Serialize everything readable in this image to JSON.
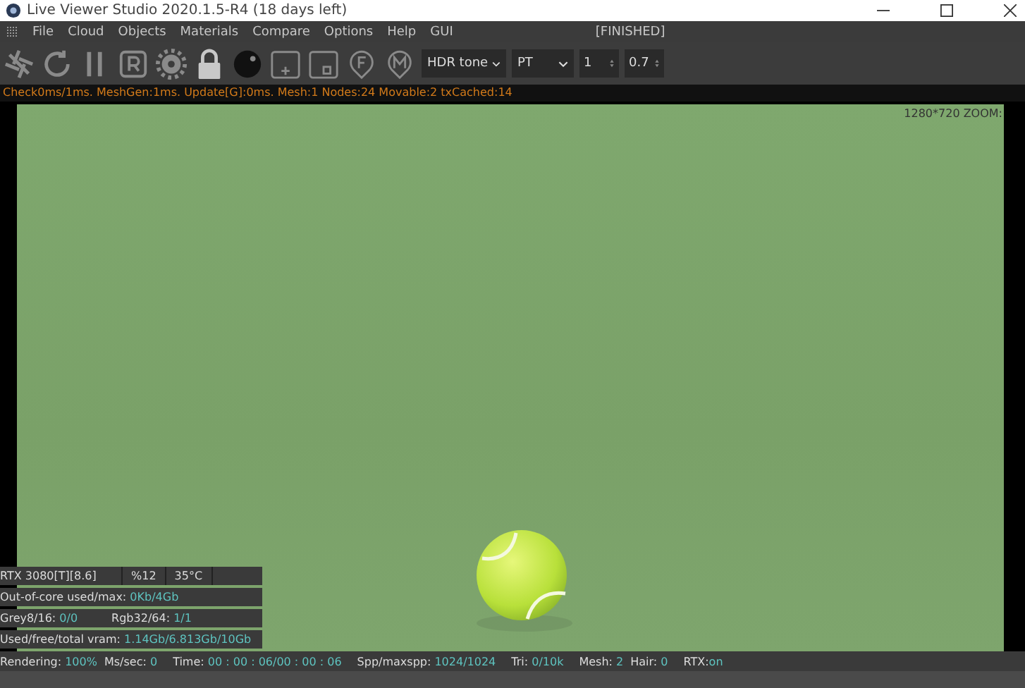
{
  "window": {
    "title": "Live Viewer Studio 2020.1.5-R4 (18 days left)"
  },
  "menu": {
    "items": [
      "File",
      "Cloud",
      "Objects",
      "Materials",
      "Compare",
      "Options",
      "Help",
      "GUI"
    ],
    "status": "[FINISHED]"
  },
  "toolbar": {
    "dropdowns": [
      "HDR tone",
      "PT"
    ],
    "spinners": [
      "1",
      "0.7"
    ]
  },
  "info_line": "Check0ms/1ms. MeshGen:1ms. Update[G]:0ms. Mesh:1 Nodes:24 Movable:2 txCached:14",
  "viewport": {
    "overlay": "1280*720 ZOOM:",
    "gpu": [
      "RTX 3080[T][8.6]",
      "%12",
      "35°C"
    ],
    "stats": [
      [
        {
          "label": "Out-of-core used/max:",
          "value": "0Kb/4Gb"
        }
      ],
      [
        {
          "label": "Grey8/16:",
          "value": "0/0"
        },
        {
          "label": "Rgb32/64:",
          "value": "1/1"
        }
      ],
      [
        {
          "label": "Used/free/total vram:",
          "value": "1.14Gb/6.813Gb/10Gb"
        }
      ]
    ]
  },
  "status_bar": [
    {
      "label": "Rendering:",
      "value": "100%"
    },
    {
      "label": "Ms/sec:",
      "value": "0"
    },
    {
      "label": "Time:",
      "value": "00 : 00 : 06/00 : 00 : 06"
    },
    {
      "label": "Spp/maxspp:",
      "value": "1024/1024"
    },
    {
      "label": "Tri:",
      "value": "0/10k"
    },
    {
      "label": "Mesh:",
      "value": "2"
    },
    {
      "label": "Hair:",
      "value": "0"
    },
    {
      "label": "RTX:",
      "value": "on"
    }
  ]
}
